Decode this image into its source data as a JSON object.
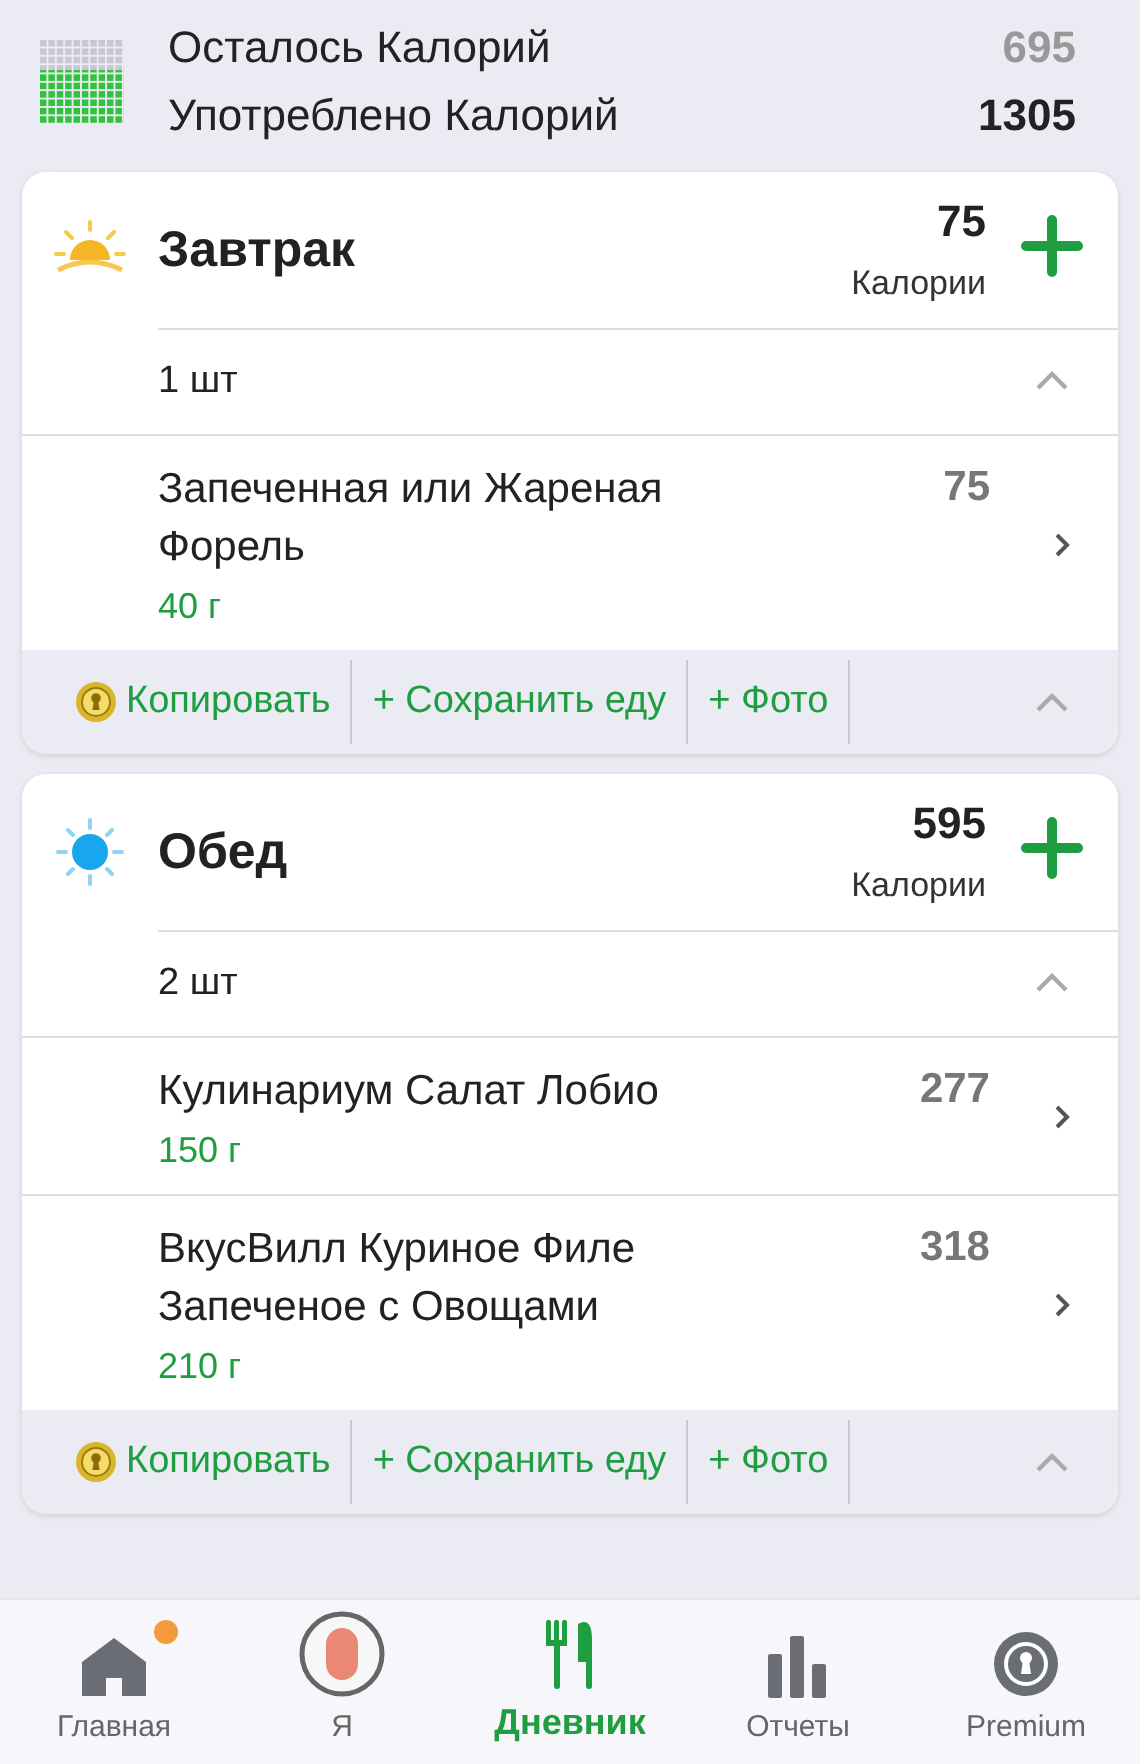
{
  "summary": {
    "rows": [
      {
        "label": "Осталось Калорий",
        "value": "695",
        "kind": "muted"
      },
      {
        "label": "Употреблено Калорий",
        "value": "1305",
        "kind": "strong"
      }
    ]
  },
  "meals": [
    {
      "kind": "sunrise",
      "title": "Завтрак",
      "calories": "75",
      "calories_label": "Калории",
      "count": "1 шт",
      "expanded": true,
      "items": [
        {
          "name": "Запеченная или Жареная Форель",
          "calories": "75",
          "amount": "40 г"
        }
      ],
      "actions": [
        "Копировать",
        "+ Сохранить еду",
        "+ Фото"
      ]
    },
    {
      "kind": "sun",
      "title": "Обед",
      "calories": "595",
      "calories_label": "Калории",
      "count": "2 шт",
      "expanded": true,
      "items": [
        {
          "name": "Кулинариум Салат Лобио",
          "calories": "277",
          "amount": "150 г"
        },
        {
          "name": "ВкусВилл Куриное Филе Запеченое с Овощами",
          "calories": "318",
          "amount": "210 г"
        }
      ],
      "actions": [
        "Копировать",
        "+ Сохранить еду",
        "+ Фото"
      ]
    }
  ],
  "nav": [
    {
      "kind": "home",
      "label": "Главная",
      "selected": false,
      "notification": true
    },
    {
      "kind": "avatar",
      "label": "Я",
      "selected": false,
      "notification": false
    },
    {
      "kind": "diary",
      "label": "Дневник",
      "selected": true,
      "notification": false
    },
    {
      "kind": "reports",
      "label": "Отчеты",
      "selected": false,
      "notification": false
    },
    {
      "kind": "premium",
      "label": "Premium",
      "selected": false,
      "notification": false
    }
  ]
}
